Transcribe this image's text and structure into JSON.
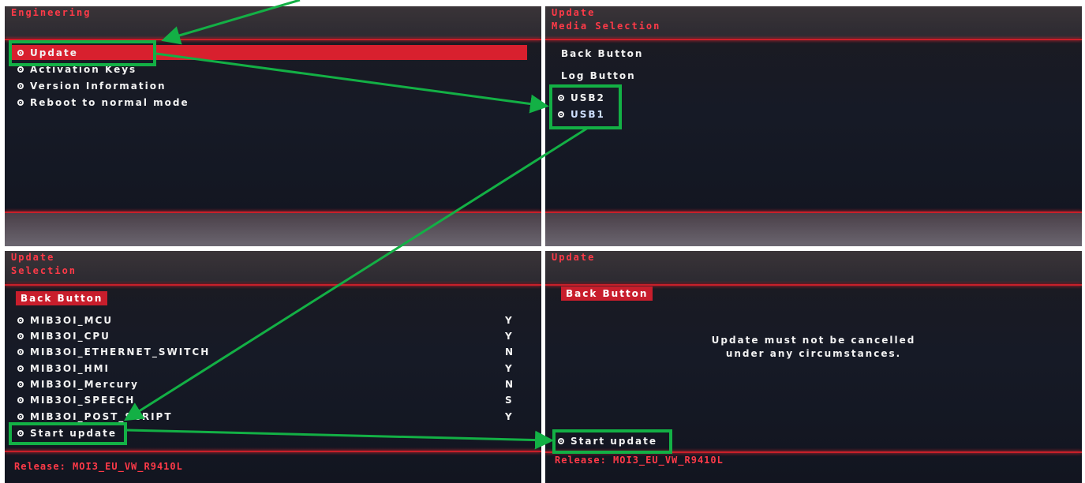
{
  "panel1": {
    "title": "Engineering",
    "items": [
      "Update",
      "Activation Keys",
      "Version Information",
      "Reboot to normal mode"
    ]
  },
  "panel2": {
    "title1": "Update",
    "title2": "Media Selection",
    "back_button": "Back Button",
    "log_button": "Log Button",
    "items": [
      "USB2",
      "USB1"
    ]
  },
  "panel3": {
    "title1": "Update",
    "title2": "Selection",
    "back_button": "Back Button",
    "rows": [
      {
        "name": "MIB3OI_MCU",
        "flag": "Y"
      },
      {
        "name": "MIB3OI_CPU",
        "flag": "Y"
      },
      {
        "name": "MIB3OI_ETHERNET_SWITCH",
        "flag": "N"
      },
      {
        "name": "MIB3OI_HMI",
        "flag": "Y"
      },
      {
        "name": "MIB3OI_Mercury",
        "flag": "N"
      },
      {
        "name": "MIB3OI_SPEECH",
        "flag": "S"
      },
      {
        "name": "MIB3OI_POST_SCRIPT",
        "flag": "Y"
      }
    ],
    "start_update": "Start update",
    "release": "Release: MOI3_EU_VW_R9410L"
  },
  "panel4": {
    "title1": "Update",
    "back_button": "Back Button",
    "message_line1": "Update must not be cancelled",
    "message_line2": "under any circumstances.",
    "start_update": "Start update",
    "release": "Release: MOI3_EU_VW_R9410L"
  },
  "colors": {
    "accent_red": "#d8202e",
    "title_red": "#ff3a48",
    "highlight_green": "#13b045",
    "screen_bg": "#161a26"
  }
}
